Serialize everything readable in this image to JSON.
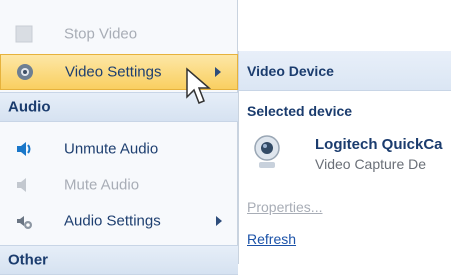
{
  "menu": {
    "items": [
      {
        "label": "Stop Video",
        "icon": "stop-video-icon",
        "disabled": true
      },
      {
        "label": "Video Settings",
        "icon": "video-settings-icon",
        "active": true,
        "submenu": true
      },
      {
        "label": "Unmute Audio",
        "icon": "speaker-on-icon"
      },
      {
        "label": "Mute Audio",
        "icon": "speaker-muted-icon",
        "disabled": true
      },
      {
        "label": "Audio Settings",
        "icon": "audio-settings-icon",
        "submenu": true
      }
    ],
    "sections": [
      "Audio",
      "Other"
    ]
  },
  "flyout": {
    "title": "Video Device",
    "subheading": "Selected device",
    "device_name": "Logitech QuickCa",
    "device_type": "Video Capture De",
    "links": [
      "Properties...",
      "Refresh"
    ]
  },
  "colors": {
    "accent": "#f9cf61",
    "section_bg": "#dbe6f4",
    "text": "#1e3f70"
  }
}
